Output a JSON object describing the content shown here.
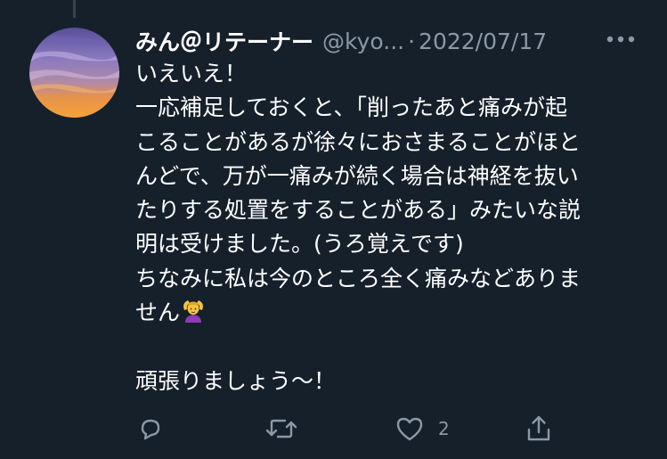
{
  "tweet": {
    "display_name": "みん＠リテーナー",
    "handle": "@kyo...",
    "separator": "·",
    "date": "2022/07/17",
    "lines": [
      "いえいえ！",
      "一応補足しておくと、「削ったあと痛みが起",
      "こることがあるが徐々におさまることがほと",
      "んどで、万が一痛みが続く場合は神経を抜い",
      "たりする処置をすることがある」みたいな説",
      "明は受けました。(うろ覚えです)",
      "ちなみに私は今のところ全く痛みなどありま",
      "せん",
      "",
      "頑張りましょう〜！"
    ],
    "emoji_name": "person-gesturing-ok-emoji"
  },
  "actions": {
    "reply_icon": "reply-icon",
    "retweet_icon": "retweet-icon",
    "like_icon": "heart-icon",
    "like_count": "2",
    "share_icon": "share-icon"
  },
  "colors": {
    "background": "#15202b",
    "text": "#ffffff",
    "secondary": "#8b98a5",
    "thread_line": "#38444d"
  }
}
